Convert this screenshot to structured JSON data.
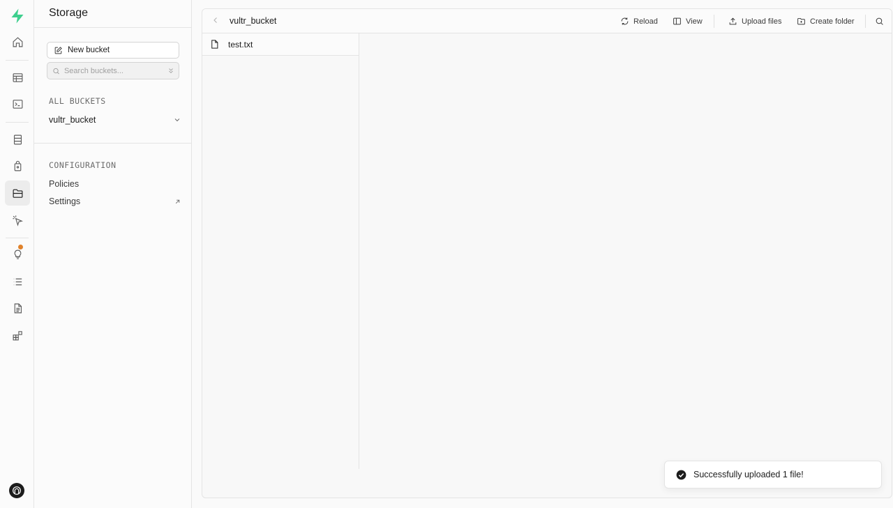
{
  "rail": {
    "items": [
      {
        "icon": "home-icon"
      },
      {
        "icon": "table-editor-icon"
      },
      {
        "icon": "sql-editor-icon"
      },
      {
        "icon": "database-icon"
      },
      {
        "icon": "authentication-icon"
      },
      {
        "icon": "storage-icon"
      },
      {
        "icon": "edge-functions-icon"
      },
      {
        "icon": "advisors-icon"
      },
      {
        "icon": "logs-icon"
      },
      {
        "icon": "api-docs-icon"
      },
      {
        "icon": "integrations-icon"
      }
    ],
    "active": "storage-icon",
    "accent": "#3ecf8e",
    "notification_color": "#e0822b"
  },
  "sidebar": {
    "title": "Storage",
    "new_bucket_label": "New bucket",
    "search": {
      "placeholder": "Search buckets...",
      "value": ""
    },
    "all_buckets_label": "ALL BUCKETS",
    "buckets": [
      {
        "name": "vultr_bucket"
      }
    ],
    "configuration_label": "CONFIGURATION",
    "config_items": [
      {
        "label": "Policies"
      },
      {
        "label": "Settings"
      }
    ]
  },
  "explorer": {
    "bucket_name": "vultr_bucket",
    "toolbar": {
      "reload_label": "Reload",
      "view_label": "View",
      "upload_label": "Upload files",
      "create_folder_label": "Create folder"
    },
    "files": [
      {
        "name": "test.txt"
      }
    ]
  },
  "toast": {
    "message": "Successfully uploaded 1 file!"
  }
}
